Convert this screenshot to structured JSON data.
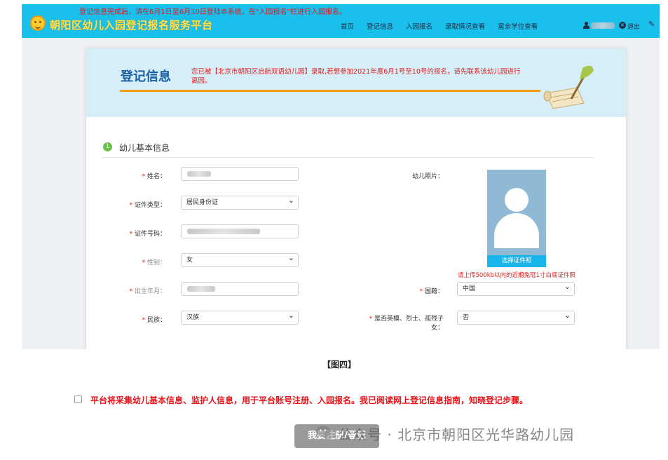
{
  "header": {
    "marquee": "登记信息完成后，请在6月1日至6月10日登陆本系统，在\"入园报名\"栏进行入园报名。",
    "brand": "朝阳区幼儿入园登记报名服务平台",
    "nav": [
      "首页",
      "登记信息",
      "入园报名",
      "录取情况查看",
      "富余学位查看"
    ],
    "logout": "退出"
  },
  "card": {
    "title": "登记信息",
    "notice": "您已被【北京市朝阳区启航双语幼儿园】录取,若想参加2021年度6月1号至10号的报名，请先联系该幼儿园进行离园。"
  },
  "section": {
    "number": "1",
    "title": "幼儿基本信息"
  },
  "form": {
    "name_label": "姓名：",
    "id_type_label": "证件类型：",
    "id_type_value": "居民身份证",
    "id_number_label": "证件号码：",
    "gender_label": "性别：",
    "gender_value": "女",
    "birth_label": "出生年月：",
    "ethnicity_label": "民族：",
    "ethnicity_value": "汉族",
    "photo_label": "幼儿照片：",
    "photo_button": "选择证件照",
    "photo_hint": "请上传500kb以内的近期免冠1寸白底证件照",
    "nationality_label": "国籍：",
    "nationality_value": "中国",
    "martyr_label_line1": "是否英模、烈士、孤残子",
    "martyr_label_line2": "女：",
    "martyr_value": "否"
  },
  "caption": "【图四】",
  "agreement": "平台将采集幼儿基本信息、监护人信息，用于平台账号注册、入园报名。我已阅读网上登记信息指南，知晓登记步骤。",
  "register_button": "我要注册/登记",
  "watermark": "公众号 · 北京市朝阳区光华路幼儿园",
  "colors": {
    "topbar": "#19c0ec",
    "brand": "#ffe34d",
    "alert_red": "#e8151b",
    "title_blue": "#1a5fa6",
    "accent_orange": "#f39c12",
    "button_grey": "#9a9a9a"
  }
}
